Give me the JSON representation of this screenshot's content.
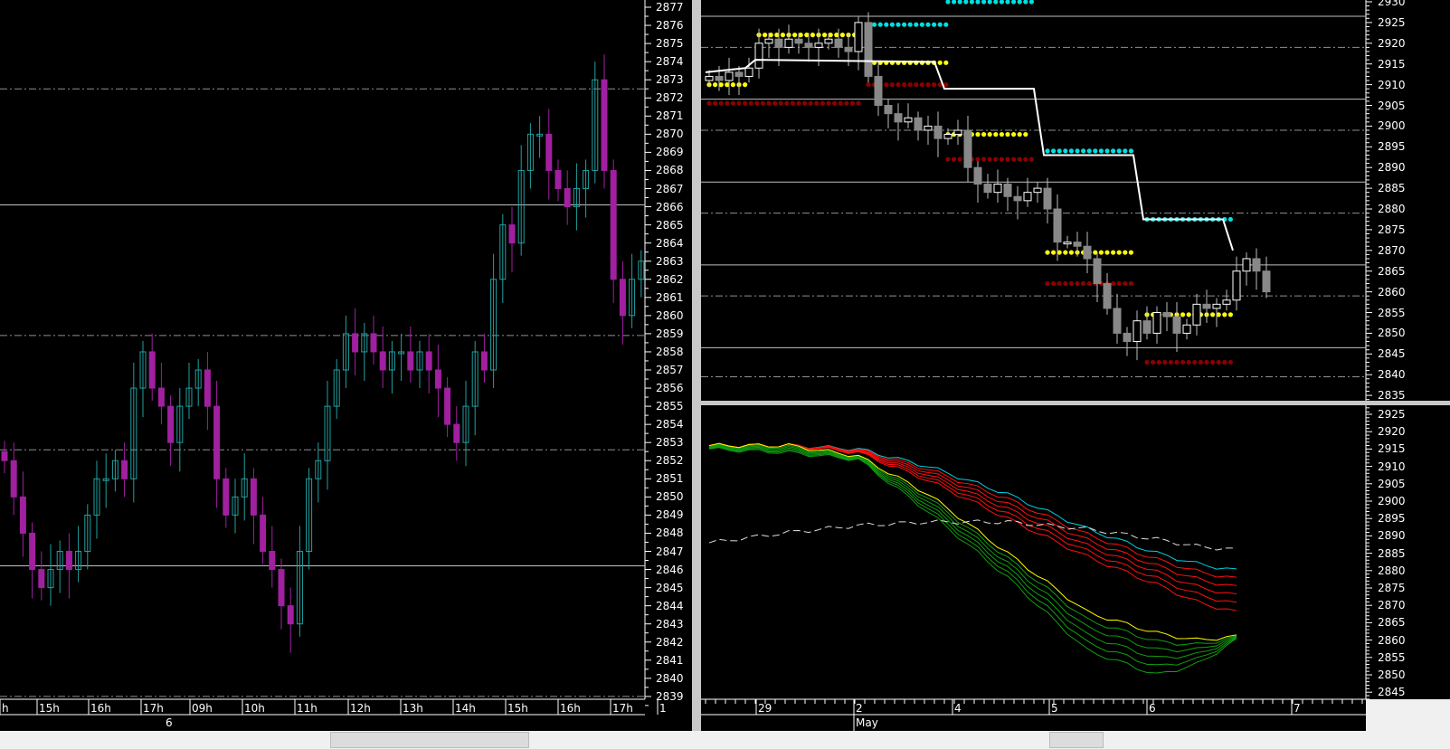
{
  "chart_data": [
    {
      "type": "candlestick",
      "name": "intraday",
      "ylim": [
        2839,
        2877
      ],
      "yticks": [
        2877,
        2876,
        2875,
        2874,
        2873,
        2872,
        2871,
        2870,
        2869,
        2868,
        2867,
        2866,
        2865,
        2864,
        2863,
        2862,
        2861,
        2860,
        2859,
        2858,
        2857,
        2856,
        2855,
        2854,
        2853,
        2852,
        2851,
        2850,
        2849,
        2848,
        2847,
        2846,
        2845,
        2844,
        2843,
        2842,
        2841,
        2840,
        2839
      ],
      "xticks": [
        "h",
        "15h",
        "16h",
        "17h",
        "09h",
        "10h",
        "11h",
        "12h",
        "13h",
        "14h",
        "15h",
        "16h",
        "17h",
        "1"
      ],
      "date_labels": [
        "6"
      ],
      "hlines_solid": [
        2866.1,
        2846.2
      ],
      "hlines_dash": [
        2872.5,
        2858.9,
        2852.6,
        2839
      ],
      "closes": [
        2852,
        2850,
        2848,
        2846,
        2845,
        2846,
        2847,
        2846,
        2847,
        2849,
        2851,
        2851,
        2852,
        2851,
        2856,
        2858,
        2856,
        2855,
        2853,
        2855,
        2856,
        2857,
        2855,
        2851,
        2849,
        2850,
        2851,
        2849,
        2847,
        2846,
        2844,
        2843,
        2847,
        2851,
        2852,
        2855,
        2857,
        2859,
        2858,
        2859,
        2858,
        2857,
        2858,
        2858,
        2857,
        2858,
        2857,
        2856,
        2854,
        2853,
        2855,
        2858,
        2857,
        2862,
        2865,
        2864,
        2868,
        2870,
        2870,
        2868,
        2867,
        2866,
        2867,
        2868,
        2873,
        2868,
        2862,
        2860,
        2862,
        2863
      ],
      "up_color": "#20a0a0",
      "down_color": "#a020a0"
    },
    {
      "type": "candlestick",
      "name": "daily-top",
      "ylim": [
        2835,
        2930
      ],
      "yticks": [
        2930,
        2925,
        2920,
        2915,
        2910,
        2905,
        2900,
        2895,
        2890,
        2885,
        2880,
        2875,
        2870,
        2865,
        2860,
        2855,
        2850,
        2845,
        2840,
        2835
      ],
      "closes": [
        2912,
        2911,
        2913,
        2912,
        2914,
        2920,
        2921,
        2919,
        2921,
        2920,
        2919,
        2920,
        2921,
        2919,
        2918,
        2925,
        2912,
        2905,
        2903,
        2901,
        2902,
        2899,
        2900,
        2897,
        2898,
        2899,
        2890,
        2886,
        2884,
        2886,
        2883,
        2882,
        2884,
        2885,
        2880,
        2872,
        2872,
        2871,
        2868,
        2862,
        2856,
        2850,
        2848,
        2853,
        2850,
        2855,
        2854,
        2850,
        2852,
        2857,
        2856,
        2857,
        2858,
        2865,
        2868,
        2865,
        2860
      ],
      "levels": [
        {
          "color": "#00e0e0",
          "price": 2930,
          "from": 24,
          "to": 33
        },
        {
          "color": "#00e0e0",
          "price": 2924.5,
          "from": 16,
          "to": 24
        },
        {
          "color": "#00e0e0",
          "price": 2894,
          "from": 34,
          "to": 43
        },
        {
          "color": "#00e0e0",
          "price": 2877.5,
          "from": 44,
          "to": 53
        },
        {
          "color": "#ffff00",
          "price": 2922,
          "from": 5,
          "to": 15
        },
        {
          "color": "#ffff00",
          "price": 2915.3,
          "from": 16,
          "to": 24
        },
        {
          "color": "#ffff00",
          "price": 2910,
          "from": 0,
          "to": 4
        },
        {
          "color": "#ffff00",
          "price": 2898,
          "from": 24,
          "to": 32
        },
        {
          "color": "#ffff00",
          "price": 2869.5,
          "from": 34,
          "to": 43
        },
        {
          "color": "#ffff00",
          "price": 2854.5,
          "from": 44,
          "to": 53
        },
        {
          "color": "#8b0000",
          "price": 2905.5,
          "from": 0,
          "to": 15
        },
        {
          "color": "#8b0000",
          "price": 2910,
          "from": 16,
          "to": 24
        },
        {
          "color": "#8b0000",
          "price": 2892,
          "from": 24,
          "to": 33
        },
        {
          "color": "#8b0000",
          "price": 2862,
          "from": 34,
          "to": 43
        },
        {
          "color": "#8b0000",
          "price": 2843,
          "from": 44,
          "to": 53
        }
      ],
      "step_line": [
        [
          0,
          2913
        ],
        [
          4,
          2914
        ],
        [
          5,
          2916
        ],
        [
          23,
          2915.5
        ],
        [
          24,
          2909
        ],
        [
          33,
          2909
        ],
        [
          34,
          2893
        ],
        [
          43,
          2893
        ],
        [
          44,
          2877.5
        ],
        [
          52,
          2877.5
        ],
        [
          53,
          2870
        ]
      ],
      "hlines_solid": [
        2926.5,
        2906.5,
        2886.5,
        2866.5,
        2846.5
      ],
      "hlines_dash": [
        2919,
        2899,
        2879,
        2859,
        2839.5
      ],
      "xticks": [
        "29",
        "2",
        "4",
        "5",
        "6",
        "7"
      ],
      "date_labels": [
        "May"
      ]
    },
    {
      "type": "line",
      "name": "ribbon",
      "ylim": [
        2843,
        2928
      ],
      "yticks": [
        2925,
        2920,
        2915,
        2910,
        2905,
        2900,
        2895,
        2890,
        2885,
        2880,
        2875,
        2870,
        2865,
        2860,
        2855,
        2850,
        2845
      ],
      "x": [
        0,
        8,
        15,
        22,
        30,
        38,
        45,
        49,
        53
      ],
      "red_top": [
        2916,
        2916,
        2915,
        2910,
        2902,
        2892,
        2885,
        2882,
        2880
      ],
      "red_bottom": [
        2916,
        2916,
        2914,
        2906,
        2895,
        2884,
        2876,
        2871,
        2868
      ],
      "yellow": [
        2916,
        2916,
        2913,
        2902,
        2885,
        2868,
        2862,
        2860,
        2861
      ],
      "green_bottom": [
        2915,
        2914,
        2912,
        2897,
        2878,
        2857,
        2850,
        2853,
        2860
      ],
      "dashed": [
        2888,
        2891,
        2893,
        2894,
        2894,
        2892,
        2889,
        2887,
        2886
      ]
    }
  ]
}
